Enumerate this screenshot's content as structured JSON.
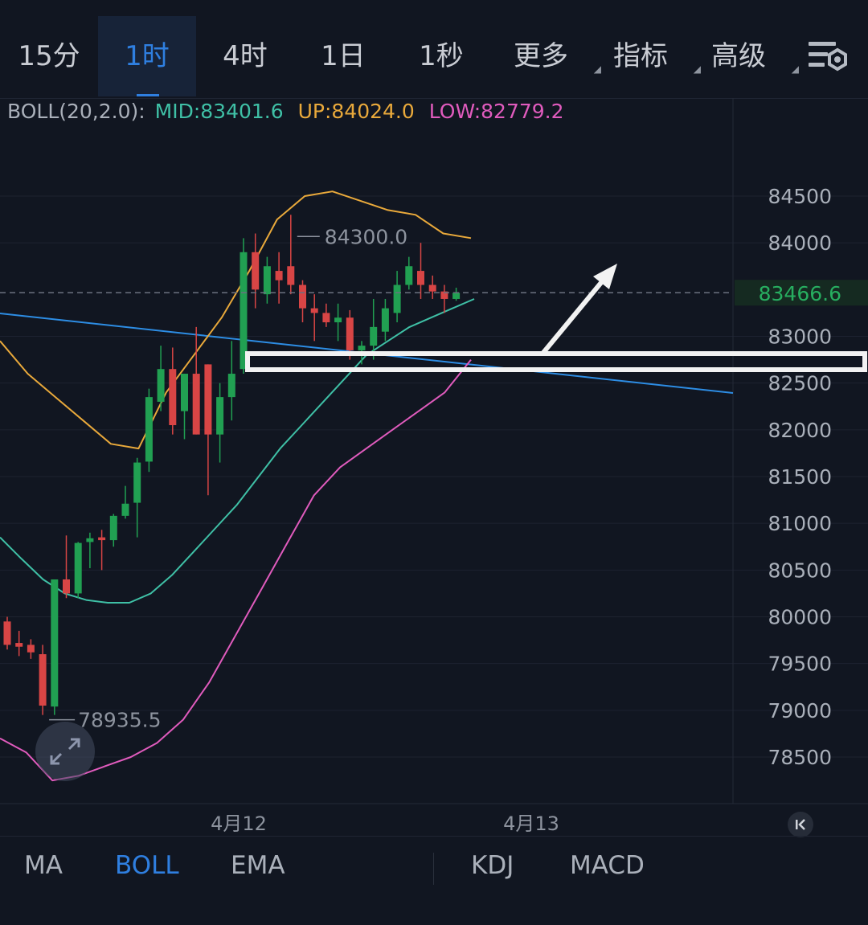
{
  "timeframe_tabs": [
    {
      "label": "15分",
      "active": false
    },
    {
      "label": "1时",
      "active": true
    },
    {
      "label": "4时",
      "active": false
    },
    {
      "label": "1日",
      "active": false
    },
    {
      "label": "1秒",
      "active": false
    },
    {
      "label": "更多",
      "active": false,
      "dropdown": true
    },
    {
      "label": "指标",
      "active": false,
      "dropdown": true
    },
    {
      "label": "高级",
      "active": false,
      "dropdown": true
    }
  ],
  "boll": {
    "name": "BOLL(20,2.0):",
    "mid_label": "MID:83401.6",
    "up_label": "UP:84024.0",
    "low_label": "LOW:82779.2"
  },
  "price_axis": [
    "84500",
    "84000",
    "83000",
    "82500",
    "82000",
    "81500",
    "81000",
    "80500",
    "80000",
    "79500",
    "79000",
    "78500"
  ],
  "current_price": "83466.6",
  "max_label": "84300.0",
  "min_label": "78935.5",
  "date_labels": [
    "4月12",
    "4月13"
  ],
  "indicator_tabs": [
    {
      "label": "MA",
      "active": false
    },
    {
      "label": "BOLL",
      "active": true
    },
    {
      "label": "EMA",
      "active": false
    },
    {
      "label": "KDJ",
      "active": false
    },
    {
      "label": "MACD",
      "active": false
    }
  ],
  "colors": {
    "up": "#21a052",
    "down": "#d84545",
    "mid": "#3fc0a6",
    "upper": "#e9a93b",
    "lower": "#e05bbd",
    "trendline": "#2d8de4",
    "accent": "#2f7fe0"
  },
  "chart_data": {
    "type": "candlestick",
    "interval": "1时",
    "ylim": [
      78000,
      85000
    ],
    "candles": [
      {
        "o": 79950,
        "h": 80000,
        "l": 79650,
        "c": 79700
      },
      {
        "o": 79720,
        "h": 79850,
        "l": 79580,
        "c": 79680
      },
      {
        "o": 79700,
        "h": 79760,
        "l": 79550,
        "c": 79620
      },
      {
        "o": 79600,
        "h": 79700,
        "l": 78950,
        "c": 79050
      },
      {
        "o": 79040,
        "h": 80400,
        "l": 78950,
        "c": 80400
      },
      {
        "o": 80400,
        "h": 80870,
        "l": 80200,
        "c": 80250
      },
      {
        "o": 80250,
        "h": 80800,
        "l": 80200,
        "c": 80790
      },
      {
        "o": 80800,
        "h": 80900,
        "l": 80520,
        "c": 80840
      },
      {
        "o": 80850,
        "h": 80930,
        "l": 80500,
        "c": 80820
      },
      {
        "o": 80820,
        "h": 81100,
        "l": 80750,
        "c": 81080
      },
      {
        "o": 81080,
        "h": 81400,
        "l": 81050,
        "c": 81210
      },
      {
        "o": 81220,
        "h": 81700,
        "l": 80850,
        "c": 81650
      },
      {
        "o": 81660,
        "h": 82440,
        "l": 81550,
        "c": 82350
      },
      {
        "o": 82300,
        "h": 82900,
        "l": 82200,
        "c": 82650
      },
      {
        "o": 82650,
        "h": 82880,
        "l": 81950,
        "c": 82050
      },
      {
        "o": 82200,
        "h": 82600,
        "l": 81900,
        "c": 82600
      },
      {
        "o": 82600,
        "h": 83100,
        "l": 81950,
        "c": 81950
      },
      {
        "o": 82700,
        "h": 82700,
        "l": 81300,
        "c": 81950
      },
      {
        "o": 81950,
        "h": 82500,
        "l": 81650,
        "c": 82350
      },
      {
        "o": 82350,
        "h": 82950,
        "l": 82100,
        "c": 82600
      },
      {
        "o": 82650,
        "h": 84050,
        "l": 82600,
        "c": 83900
      },
      {
        "o": 83900,
        "h": 84100,
        "l": 83300,
        "c": 83500
      },
      {
        "o": 83450,
        "h": 83850,
        "l": 83350,
        "c": 83750
      },
      {
        "o": 83700,
        "h": 83900,
        "l": 83350,
        "c": 83600
      },
      {
        "o": 83750,
        "h": 84300,
        "l": 83450,
        "c": 83550
      },
      {
        "o": 83550,
        "h": 83600,
        "l": 83150,
        "c": 83300
      },
      {
        "o": 83300,
        "h": 83450,
        "l": 82950,
        "c": 83250
      },
      {
        "o": 83250,
        "h": 83350,
        "l": 83100,
        "c": 83150
      },
      {
        "o": 83150,
        "h": 83350,
        "l": 82950,
        "c": 83200
      },
      {
        "o": 83200,
        "h": 83280,
        "l": 82750,
        "c": 82850
      },
      {
        "o": 82850,
        "h": 82950,
        "l": 82700,
        "c": 82900
      },
      {
        "o": 82900,
        "h": 83400,
        "l": 82750,
        "c": 83100
      },
      {
        "o": 83050,
        "h": 83400,
        "l": 82950,
        "c": 83300
      },
      {
        "o": 83250,
        "h": 83700,
        "l": 83150,
        "c": 83550
      },
      {
        "o": 83550,
        "h": 83850,
        "l": 83500,
        "c": 83750
      },
      {
        "o": 83700,
        "h": 84000,
        "l": 83400,
        "c": 83550
      },
      {
        "o": 83550,
        "h": 83650,
        "l": 83400,
        "c": 83480
      },
      {
        "o": 83480,
        "h": 83550,
        "l": 83250,
        "c": 83400
      },
      {
        "o": 83400,
        "h": 83520,
        "l": 83380,
        "c": 83466.6
      }
    ],
    "boll_mid": [
      80850,
      80620,
      80400,
      80250,
      80180,
      80150,
      80150,
      80250,
      80450,
      80700,
      80950,
      81200,
      81500,
      81800,
      82050,
      82300,
      82550,
      82800,
      82950,
      83100,
      83200,
      83300,
      83400
    ],
    "boll_upper": [
      82950,
      82600,
      82350,
      82100,
      81850,
      81800,
      82400,
      82800,
      83200,
      83700,
      84250,
      84500,
      84550,
      84450,
      84350,
      84300,
      84100,
      84050
    ],
    "boll_lower": [
      78700,
      78550,
      78250,
      78300,
      78400,
      78500,
      78650,
      78900,
      79300,
      79800,
      80300,
      80800,
      81300,
      81600,
      81800,
      82000,
      82200,
      82400,
      82750
    ]
  }
}
